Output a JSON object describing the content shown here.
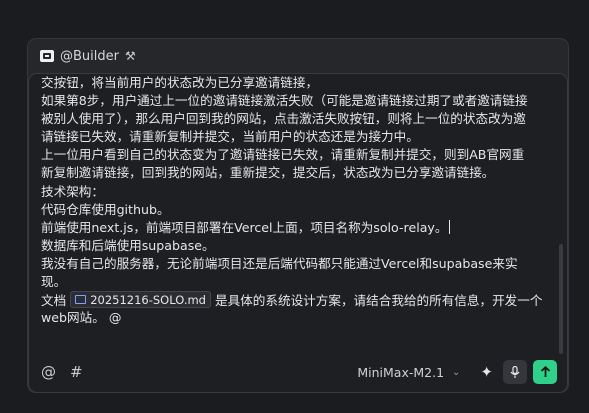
{
  "header": {
    "agent_label": "@Builder",
    "agent_icon": "agent-icon",
    "tools_icon": "tools-icon"
  },
  "editor": {
    "lines": [
      "交按钮，将当前用户的状态改为已分享邀请链接，",
      "如果第8步，用户通过上一位的邀请链接激活失败（可能是邀请链接过期了或者邀请链接",
      "被别人使用了），那么用户回到我的网站，点击激活失败按钮，则将上一位的状态改为邀",
      "请链接已失效，请重新复制并提交，当前用户的状态还是为接力中。",
      "上一位用户看到自己的状态变为了邀请链接已失效，请重新复制并提交，则到AB官网重",
      "新复制邀请链接，回到我的网站，重新提交，提交后，状态改为已分享邀请链接。",
      "技术架构：",
      "代码仓库使用github。",
      "前端使用next.js，前端项目部署在Vercel上面，项目名称为solo-relay。",
      "数据库和后端使用supabase。",
      "我没有自己的服务器，无论前端项目还是后端代码都只能通过Vercel和supabase来实",
      "现。"
    ],
    "last_prefix": "文档",
    "file_chip": "20251216-SOLO.md",
    "last_suffix": "是具体的系统设计方案，请结合我给的所有信息，开发一个",
    "final_line": "web网站。 @"
  },
  "toolbar": {
    "at_icon": "@",
    "hash_icon": "#",
    "model": "MiniMax-M2.1",
    "sparkle_icon": "sparkle-icon",
    "mic_icon": "mic-icon",
    "send_icon": "send-icon"
  },
  "colors": {
    "accent": "#2fd08a",
    "panel": "#26272b",
    "editor": "#1e1f22"
  }
}
